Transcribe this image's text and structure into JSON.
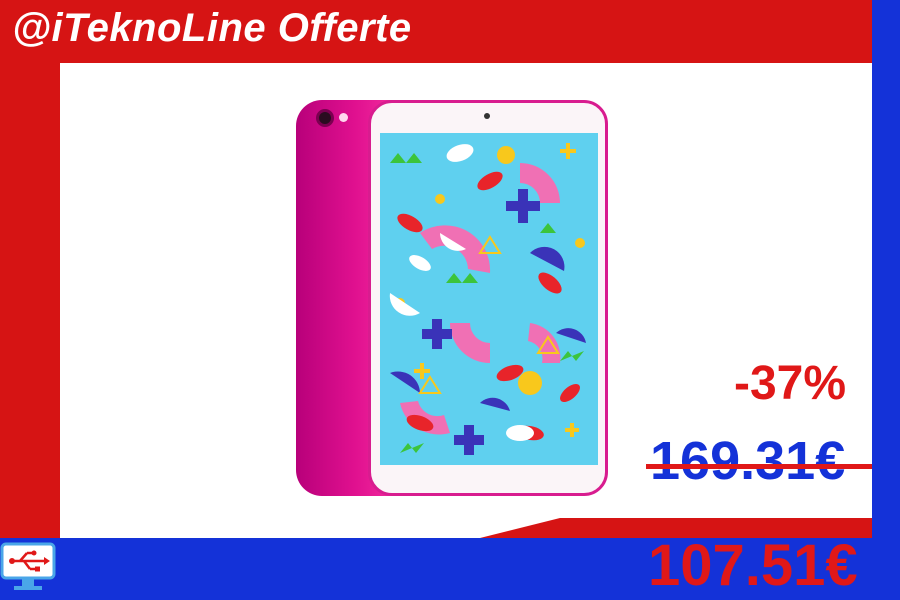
{
  "header": {
    "title": "@iTeknoLine Offerte"
  },
  "product": {
    "image_icon": "pink-tablet-icon"
  },
  "pricing": {
    "discount": "-37%",
    "original_price": "169.31€",
    "sale_price": "107.51€"
  },
  "logo": {
    "icon": "usb-monitor-icon"
  },
  "colors": {
    "red": "#d61414",
    "blue": "#1432d8",
    "white": "#ffffff",
    "pink": "#e0108f"
  }
}
